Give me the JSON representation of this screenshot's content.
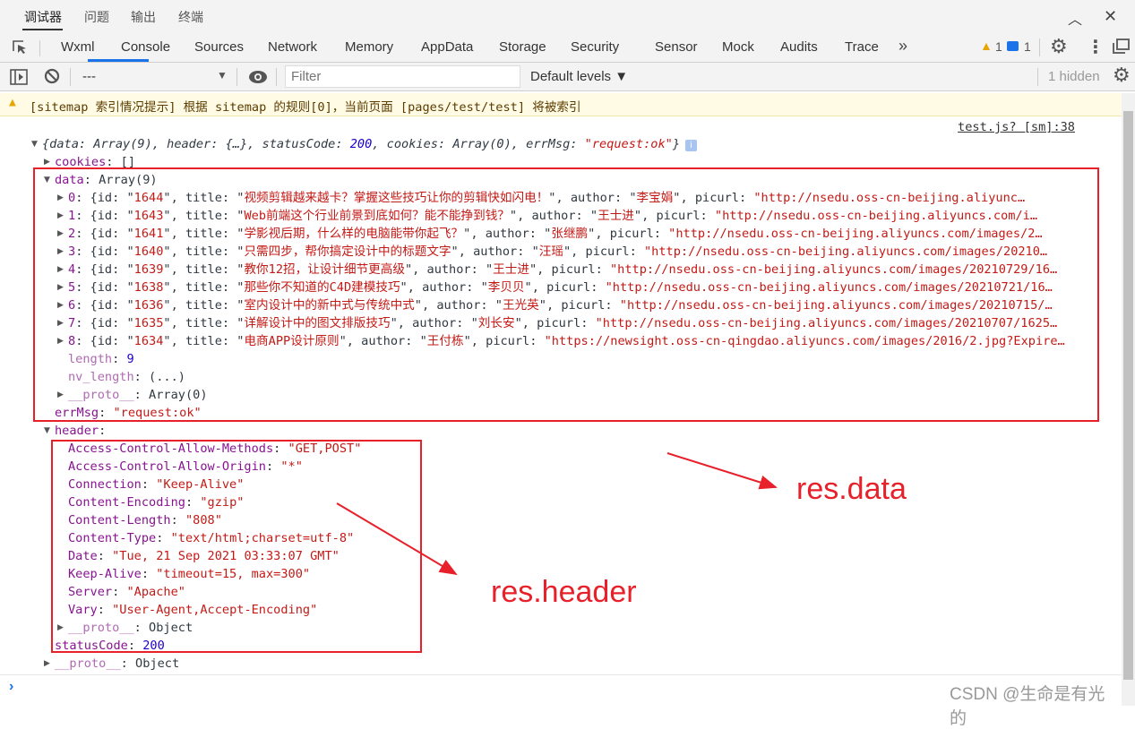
{
  "top_tabs": [
    "调试器",
    "问题",
    "输出",
    "终端"
  ],
  "panel_tabs": [
    "Wxml",
    "Console",
    "Sources",
    "Network",
    "Memory",
    "AppData",
    "Storage",
    "Security",
    "Sensor",
    "Mock",
    "Audits",
    "Trace"
  ],
  "more_tabs": "»",
  "warn_count": "1",
  "msg_count": "1",
  "filterbar": {
    "context": "---",
    "filter_placeholder": "Filter",
    "levels": "Default levels ▼",
    "hidden": "1 hidden"
  },
  "warning": "[sitemap 索引情况提示] 根据 sitemap 的规则[0]，当前页面 [pages/test/test] 将被索引",
  "source_link": "test.js? [sm]:38",
  "summary": {
    "p1": "{data: Array(9), header: {…}, statusCode: ",
    "code": "200",
    "p2": ", cookies: Array(0), errMsg: ",
    "msg": "\"request:ok\"",
    "p3": "}"
  },
  "cookies": {
    "key": "cookies",
    "val": ": []"
  },
  "data_label": {
    "key": "data",
    "val": ": Array(9)"
  },
  "data_items": [
    {
      "idx": "0",
      "id": "1644",
      "title": "视频剪辑越来越卡？掌握这些技巧让你的剪辑快如闪电！",
      "author": "李宝娟",
      "picurl": "\"http://nsedu.oss-cn-beijing.aliyunc…"
    },
    {
      "idx": "1",
      "id": "1643",
      "title": "Web前端这个行业前景到底如何？能不能挣到钱？",
      "author": "王士进",
      "picurl": "\"http://nsedu.oss-cn-beijing.aliyuncs.com/i…"
    },
    {
      "idx": "2",
      "id": "1641",
      "title": "学影视后期，什么样的电脑能带你起飞？",
      "author": "张继鹏",
      "picurl": "\"http://nsedu.oss-cn-beijing.aliyuncs.com/images/2…"
    },
    {
      "idx": "3",
      "id": "1640",
      "title": "只需四步，帮你搞定设计中的标题文字",
      "author": "汪瑶",
      "picurl": "\"http://nsedu.oss-cn-beijing.aliyuncs.com/images/20210…"
    },
    {
      "idx": "4",
      "id": "1639",
      "title": "教你12招，让设计细节更高级",
      "author": "王士进",
      "picurl": "\"http://nsedu.oss-cn-beijing.aliyuncs.com/images/20210729/16…"
    },
    {
      "idx": "5",
      "id": "1638",
      "title": "那些你不知道的C4D建模技巧",
      "author": "李贝贝",
      "picurl": "\"http://nsedu.oss-cn-beijing.aliyuncs.com/images/20210721/16…"
    },
    {
      "idx": "6",
      "id": "1636",
      "title": "室内设计中的新中式与传统中式",
      "author": "王光英",
      "picurl": "\"http://nsedu.oss-cn-beijing.aliyuncs.com/images/20210715/…"
    },
    {
      "idx": "7",
      "id": "1635",
      "title": "详解设计中的图文排版技巧",
      "author": "刘长安",
      "picurl": "\"http://nsedu.oss-cn-beijing.aliyuncs.com/images/20210707/1625…"
    },
    {
      "idx": "8",
      "id": "1634",
      "title": "电商APP设计原则",
      "author": "王付栋",
      "picurl": "\"https://newsight.oss-cn-qingdao.aliyuncs.com/images/2016/2.jpg?Expire…"
    }
  ],
  "length": {
    "key": "length",
    "val": "9"
  },
  "nv_length": {
    "key": "nv_length",
    "val": ": (...)"
  },
  "data_proto": {
    "key": "__proto__",
    "val": ": Array(0)"
  },
  "errMsg": {
    "key": "errMsg",
    "val": "\"request:ok\""
  },
  "header_label": "header",
  "headers": [
    {
      "key": "Access-Control-Allow-Methods",
      "val": "\"GET,POST\""
    },
    {
      "key": "Access-Control-Allow-Origin",
      "val": "\"*\""
    },
    {
      "key": "Connection",
      "val": "\"Keep-Alive\""
    },
    {
      "key": "Content-Encoding",
      "val": "\"gzip\""
    },
    {
      "key": "Content-Length",
      "val": "\"808\""
    },
    {
      "key": "Content-Type",
      "val": "\"text/html;charset=utf-8\""
    },
    {
      "key": "Date",
      "val": "\"Tue, 21 Sep 2021 03:33:07 GMT\""
    },
    {
      "key": "Keep-Alive",
      "val": "\"timeout=15, max=300\""
    },
    {
      "key": "Server",
      "val": "\"Apache\""
    },
    {
      "key": "Vary",
      "val": "\"User-Agent,Accept-Encoding\""
    }
  ],
  "header_proto": {
    "key": "__proto__",
    "val": ": Object"
  },
  "statusCode": {
    "key": "statusCode",
    "val": "200"
  },
  "root_proto": {
    "key": "__proto__",
    "val": ": Object"
  },
  "annotations": {
    "data": "res.data",
    "header": "res.header"
  },
  "watermark": "CSDN @生命是有光的",
  "colors": {
    "accent": "#1a73e8",
    "annotation": "#e8202a",
    "key": "#881391",
    "string": "#c41a16",
    "number": "#1c00cf"
  }
}
